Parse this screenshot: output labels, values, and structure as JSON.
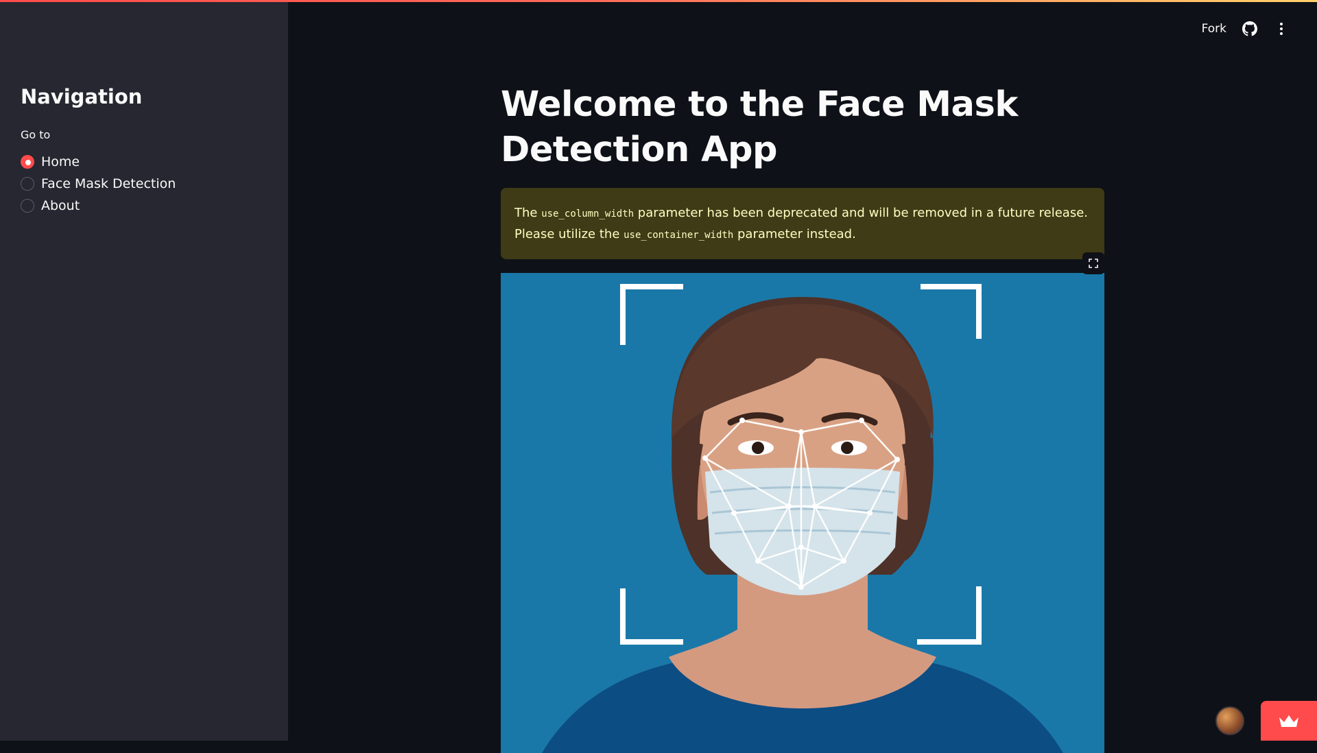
{
  "sidebar": {
    "title": "Navigation",
    "radio_label": "Go to",
    "options": [
      {
        "label": "Home",
        "selected": true
      },
      {
        "label": "Face Mask Detection",
        "selected": false
      },
      {
        "label": "About",
        "selected": false
      }
    ]
  },
  "header": {
    "fork_label": "Fork",
    "icons": [
      "github-icon",
      "kebab-menu-icon"
    ]
  },
  "main": {
    "title": "Welcome to the Face Mask Detection App",
    "warning": {
      "part1": "The ",
      "code1": "use_column_width",
      "part2": " parameter has been deprecated and will be removed in a future release. Please utilize the ",
      "code2": "use_container_width",
      "part3": " parameter instead."
    }
  },
  "colors": {
    "accent": "#ff4b4b",
    "sidebar_bg": "#262730",
    "main_bg": "#0e1117",
    "warning_bg": "#3e3b16",
    "warning_text": "#ffffc2",
    "image_bg": "#1a78a8"
  }
}
